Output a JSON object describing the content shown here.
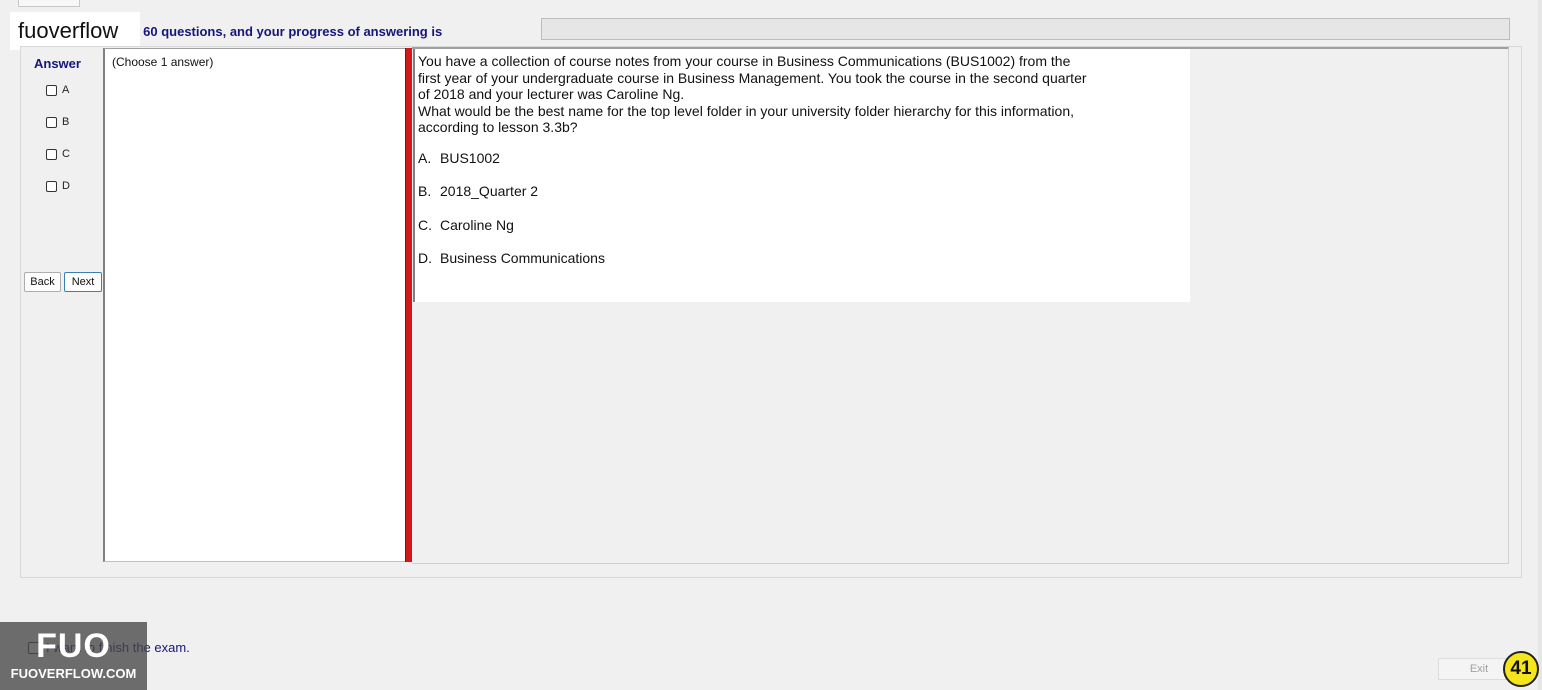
{
  "header": {
    "watermark_text": "fuoverflow",
    "progress_text": "are 60 questions, and your progress of answering is",
    "progress_value": 0
  },
  "answer_panel": {
    "title": "Answer",
    "options": [
      "A",
      "B",
      "C",
      "D"
    ],
    "back_label": "Back",
    "next_label": "Next"
  },
  "choose_panel": {
    "label": "(Choose 1 answer)"
  },
  "question": {
    "lines": [
      "You have a collection of course notes from your course in Business Communications (BUS1002) from the",
      "first year of your undergraduate course in Business Management. You took the course in the second quarter",
      "of 2018 and your lecturer was Caroline Ng.",
      "What would be the best name for the top level folder in your university folder hierarchy for this information,",
      "according to lesson 3.3b?"
    ],
    "options": [
      {
        "letter": "A.",
        "text": "BUS1002"
      },
      {
        "letter": "B.",
        "text": "2018_Quarter 2"
      },
      {
        "letter": "C.",
        "text": "Caroline Ng"
      },
      {
        "letter": "D.",
        "text": "Business Communications"
      }
    ]
  },
  "footer": {
    "finish_label": "I want to finish the exam.",
    "exit_label": "Exit",
    "page_badge": "41",
    "logo_big": "FUO",
    "logo_small": "FUOVERFLOW.COM"
  },
  "colors": {
    "header_text": "#16157a",
    "splitter": "#d21818",
    "badge": "#f5e51c"
  }
}
